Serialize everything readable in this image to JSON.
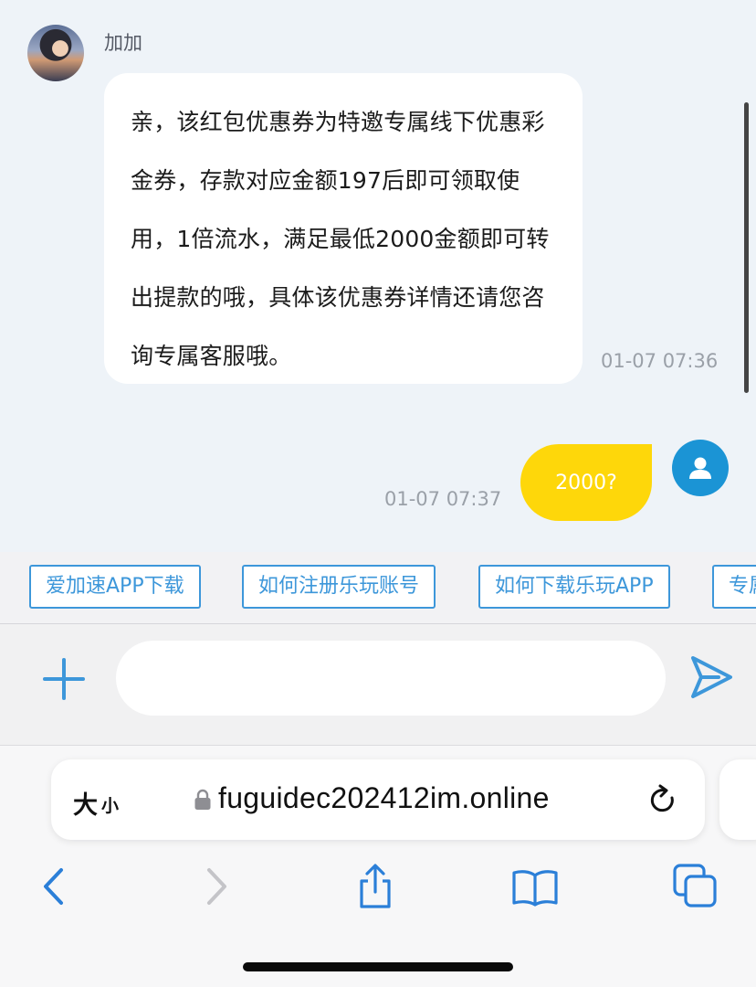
{
  "chat": {
    "sender_name": "加加",
    "incoming": {
      "lines": [
        "亲，该红包优惠券为特邀专属线下优惠彩",
        "金券，存款对应金额197后即可领取使",
        "用，1倍流水，满足最低2000金额即可转",
        "出提款的哦，具体该优惠券详情还请您咨",
        "询专属客服哦。"
      ],
      "time": "01-07 07:36"
    },
    "outgoing": {
      "text": "2000?",
      "time": "01-07 07:37"
    }
  },
  "quick_replies": [
    "爱加速APP下载",
    "如何注册乐玩账号",
    "如何下载乐玩APP",
    "专属"
  ],
  "composer": {
    "placeholder": "",
    "value": "",
    "plus_icon": "plus-icon",
    "send_icon": "send-icon"
  },
  "browser": {
    "text_size_big": "大",
    "text_size_small": "小",
    "url": "fuguidec202412im.online",
    "toolbar_icons": [
      "back-icon",
      "forward-icon",
      "share-icon",
      "bookmarks-icon",
      "tabs-icon"
    ]
  },
  "colors": {
    "chat_bg": "#eef3f8",
    "accent_blue": "#3d97da",
    "outgoing_bubble": "#fed70a",
    "user_avatar": "#1b94d5"
  }
}
